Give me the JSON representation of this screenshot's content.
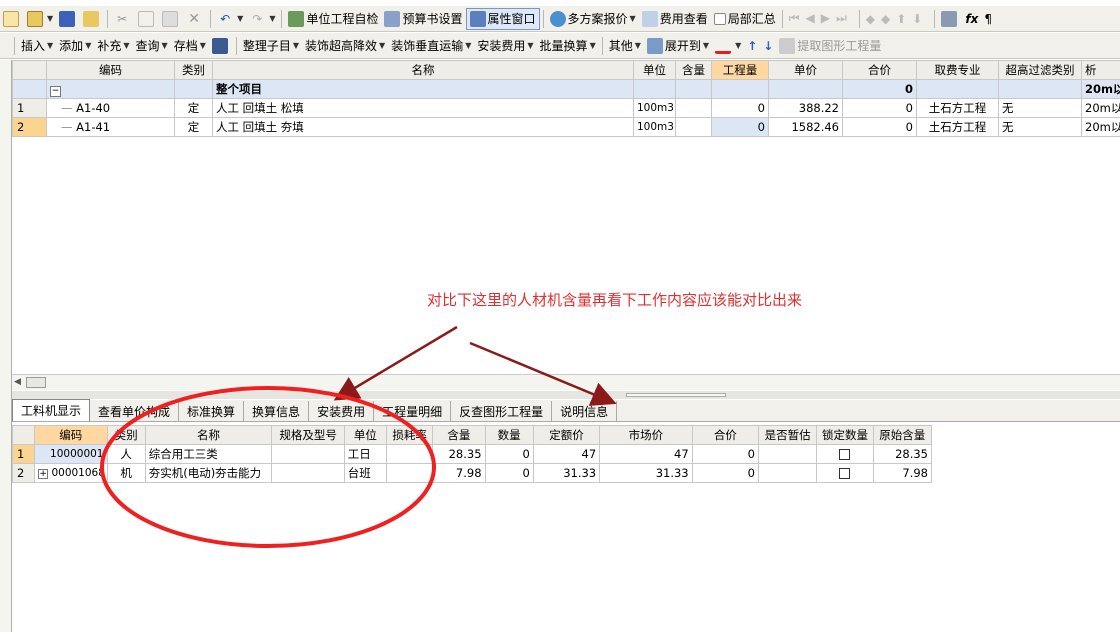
{
  "toolbar1": [
    {
      "icon": "new-file-icon",
      "label": ""
    },
    {
      "icon": "open-folder-icon",
      "label": ""
    },
    {
      "icon": "save-icon",
      "label": ""
    },
    {
      "icon": "folder-icon",
      "label": ""
    },
    {
      "icon": "cut-icon",
      "label": ""
    },
    {
      "icon": "copy-icon",
      "label": ""
    },
    {
      "icon": "paste-icon",
      "label": ""
    },
    {
      "icon": "delete-icon",
      "label": ""
    },
    {
      "icon": "undo-icon",
      "label": ""
    },
    {
      "icon": "redo-icon",
      "label": ""
    },
    {
      "icon": "self-check-icon",
      "label": "单位工程自检"
    },
    {
      "icon": "budget-settings-icon",
      "label": "预算书设置"
    },
    {
      "icon": "property-window-icon",
      "label": "属性窗口"
    },
    {
      "icon": "multi-plan-icon",
      "label": "多方案报价"
    },
    {
      "icon": "fee-view-icon",
      "label": "费用查看"
    },
    {
      "icon": "checkbox-icon",
      "label": "局部汇总"
    }
  ],
  "toolbar2": [
    "插入",
    "添加",
    "补充",
    "查询",
    "存档",
    "整理子目",
    "装饰超高降效",
    "装饰垂直运输",
    "安装费用",
    "批量换算",
    "其他",
    "展开到",
    "提取图形工程量"
  ],
  "upper": {
    "headers": [
      "编码",
      "类别",
      "名称",
      "单位",
      "含量",
      "工程量",
      "单价",
      "合价",
      "取费专业",
      "超高过滤类别",
      "析"
    ],
    "whole": {
      "label": "整个项目",
      "total": "0",
      "filter": "20m以"
    },
    "rows": [
      {
        "num": "1",
        "code": "A1-40",
        "type": "定",
        "name": "人工 回填土 松填",
        "unit": "100m3",
        "content": "",
        "qty": "0",
        "price": "388.22",
        "total": "0",
        "major": "土石方工程",
        "excl": "无",
        "filter": "20m以"
      },
      {
        "num": "2",
        "code": "A1-41",
        "type": "定",
        "name": "人工 回填土 夯填",
        "unit": "100m3",
        "content": "",
        "qty": "0",
        "price": "1582.46",
        "total": "0",
        "major": "土石方工程",
        "excl": "无",
        "filter": "20m以"
      }
    ]
  },
  "annotation": "对比下这里的人材机含量再看下工作内容应该能对比出来",
  "tabs": [
    "工料机显示",
    "查看单价构成",
    "标准换算",
    "换算信息",
    "安装费用",
    "工程量明细",
    "反查图形工程量",
    "说明信息"
  ],
  "lower": {
    "headers": [
      "编码",
      "类别",
      "名称",
      "规格及型号",
      "单位",
      "损耗率",
      "含量",
      "数量",
      "定额价",
      "市场价",
      "合价",
      "是否暂估",
      "锁定数量",
      "原始含量"
    ],
    "rows": [
      {
        "num": "1",
        "code": "10000001",
        "type": "人",
        "name": "综合用工三类",
        "spec": "",
        "unit": "工日",
        "loss": "",
        "content": "28.35",
        "qty": "0",
        "quota": "47",
        "market": "47",
        "total": "0",
        "est": "",
        "lock": "",
        "orig": "28.35"
      },
      {
        "num": "2",
        "code": "00001068",
        "type": "机",
        "name": "夯实机(电动)夯击能力",
        "spec": "",
        "unit": "台班",
        "loss": "",
        "content": "7.98",
        "qty": "0",
        "quota": "31.33",
        "market": "31.33",
        "total": "0",
        "est": "",
        "lock": "",
        "orig": "7.98"
      }
    ]
  },
  "colors": {
    "annotation": "#e03030",
    "highlight": "#ffd7a0",
    "whole_row": "#dce6f4"
  }
}
